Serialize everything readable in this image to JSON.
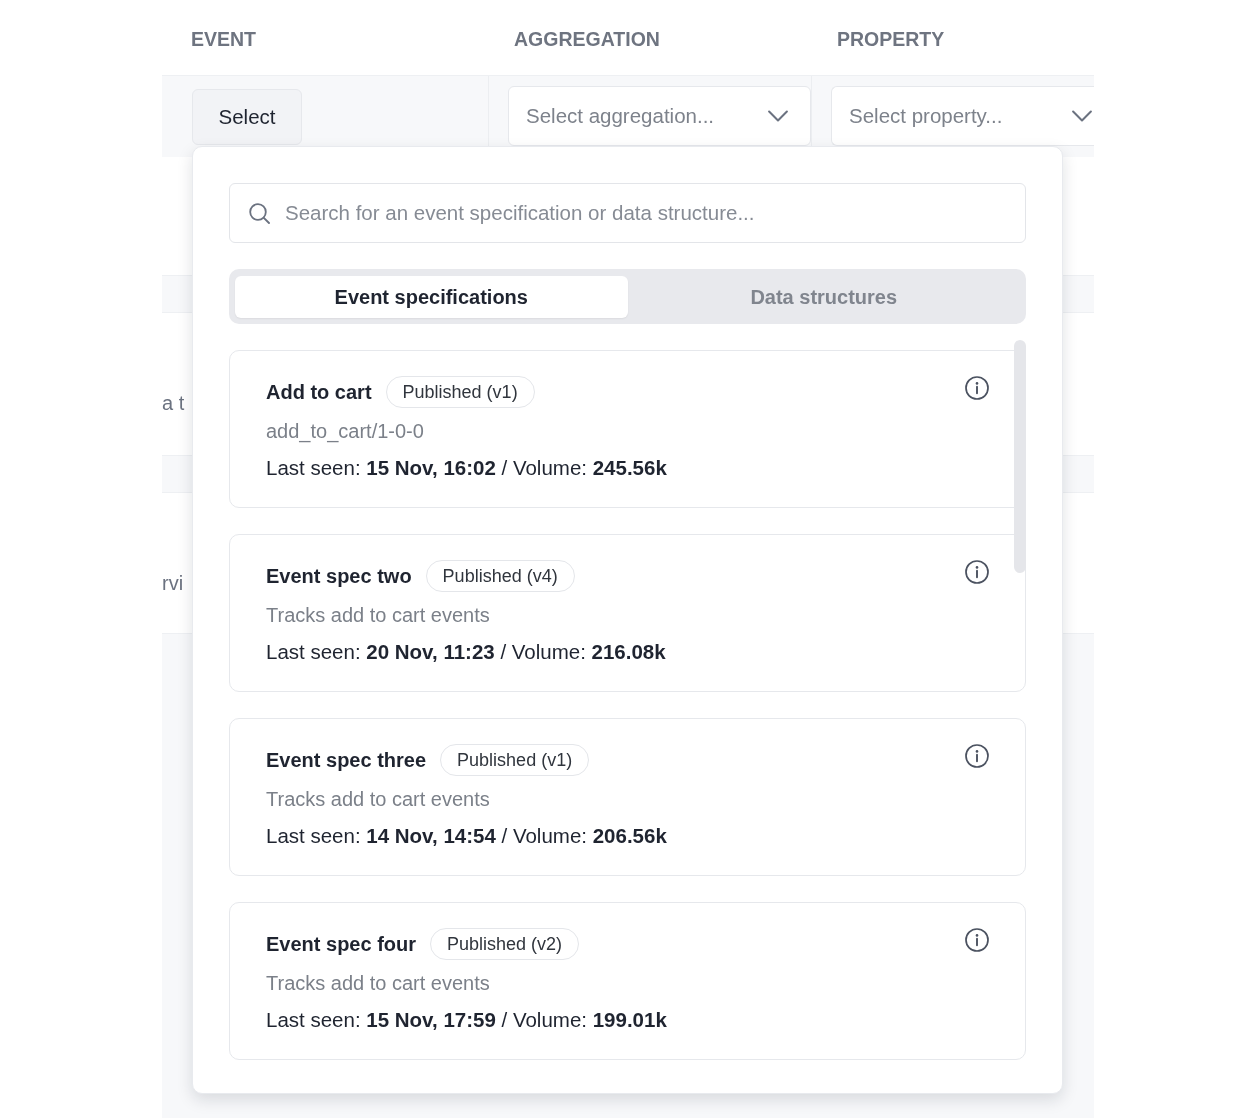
{
  "table": {
    "columns": [
      "EVENT",
      "AGGREGATION",
      "PROPERTY"
    ],
    "query_row": {
      "event_button": "Select",
      "aggregation_select": {
        "placeholder": "Select aggregation..."
      },
      "property_select": {
        "placeholder": "Select property..."
      }
    },
    "rows": [
      {
        "column_1": "a t"
      },
      {
        "column_1": "rvi"
      }
    ]
  },
  "popover": {
    "search": {
      "placeholder": "Search for an event specification or data structure..."
    },
    "tabs": [
      {
        "label": "Event specifications",
        "selected": true
      },
      {
        "label": "Data structures",
        "selected": false
      }
    ],
    "items": [
      {
        "name": "Add to cart",
        "status": "Published (v1)",
        "description": "add_to_cart/1-0-0",
        "meta": "Last seen: **15 Nov, 16:02** / Volume: **245.56k**"
      },
      {
        "name": "Event spec two",
        "status": "Published (v4)",
        "description": "Tracks add to cart events",
        "meta": "Last seen: **20 Nov, 11:23** / Volume: **216.08k**"
      },
      {
        "name": "Event spec three",
        "status": "Published (v1)",
        "description": "Tracks add to cart events",
        "meta": "Last seen: **14 Nov, 14:54** / Volume: **206.56k**"
      },
      {
        "name": "Event spec four",
        "status": "Published (v2)",
        "description": "Tracks add to cart events",
        "meta": "Last seen: **15 Nov, 17:59** / Volume: **199.01k**"
      }
    ]
  }
}
